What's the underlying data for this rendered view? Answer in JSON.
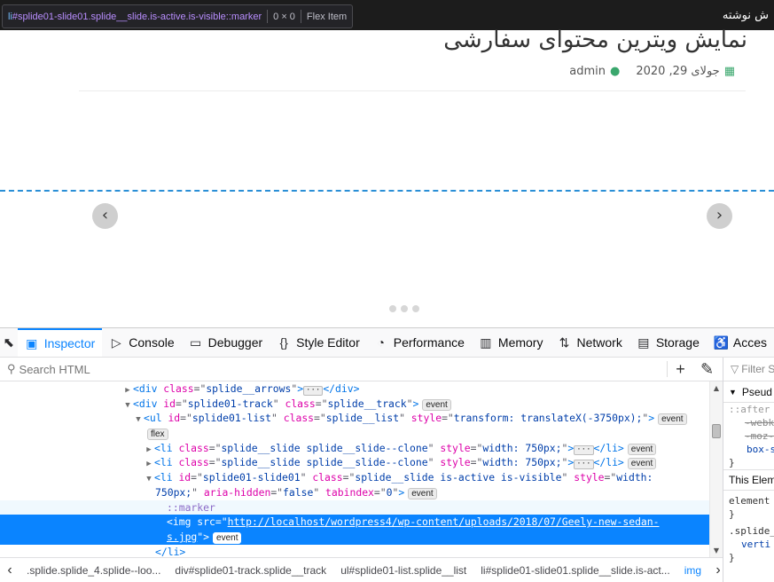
{
  "page": {
    "topbar_text": "ش نوشته",
    "post_title": "نمایش ویترین محتوای سفارشی",
    "meta_date": "جولای 29, 2020",
    "meta_author": "admin",
    "colors": {
      "accent": "#0a84ff",
      "meta_icon": "#3aa76d",
      "outline": "#2a8fd6"
    }
  },
  "tooltip": {
    "tag": "li",
    "selector": "#splide01-slide01.splide__slide.is-active.is-visible::marker",
    "size": "0 × 0",
    "layout": "Flex Item"
  },
  "devtools": {
    "tabs": [
      {
        "label": "Inspector",
        "icon": "inspector-icon"
      },
      {
        "label": "Console",
        "icon": "console-icon"
      },
      {
        "label": "Debugger",
        "icon": "debugger-icon"
      },
      {
        "label": "Style Editor",
        "icon": "style-editor-icon"
      },
      {
        "label": "Performance",
        "icon": "performance-icon"
      },
      {
        "label": "Memory",
        "icon": "memory-icon"
      },
      {
        "label": "Network",
        "icon": "network-icon"
      },
      {
        "label": "Storage",
        "icon": "storage-icon"
      },
      {
        "label": "Acces",
        "icon": "accessibility-icon"
      }
    ],
    "search_placeholder": "Search HTML",
    "markup": {
      "l1": {
        "tag": "div",
        "attr": "class",
        "val": "splide__arrows"
      },
      "l2": {
        "tag": "div",
        "a1": "id",
        "v1": "splide01-track",
        "a2": "class",
        "v2": "splide__track",
        "badge": "event"
      },
      "l3": {
        "tag": "ul",
        "a1": "id",
        "v1": "splide01-list",
        "a2": "class",
        "v2": "splide__list",
        "a3": "style",
        "v3": "transform: translateX(-3750px);",
        "badge": "event",
        "badge2": "flex"
      },
      "l4": {
        "tag": "li",
        "a1": "class",
        "v1": "splide__slide splide__slide--clone",
        "a2": "style",
        "v2": "width: 750px;",
        "badge": "event"
      },
      "l5": {
        "tag": "li",
        "a1": "class",
        "v1": "splide__slide splide__slide--clone",
        "a2": "style",
        "v2": "width: 750px;",
        "badge": "event"
      },
      "l6": {
        "tag": "li",
        "a1": "id",
        "v1": "splide01-slide01",
        "a2": "class",
        "v2": "splide__slide is-active is-visible",
        "a3": "style",
        "v3a": "width:",
        "v3b": "750px;",
        "a4": "aria-hidden",
        "v4": "false",
        "a5": "tabindex",
        "v5": "0",
        "badge": "event"
      },
      "l7": "::marker",
      "l8": {
        "tag": "img",
        "attr": "src",
        "url_a": "http://localhost/wordpress4/wp-content/uploads/2018/07/Geely-new-sedan-",
        "url_b": "s.jpg",
        "badge": "event"
      },
      "l9": "</li>"
    },
    "breadcrumbs": [
      ".splide.splide_4.splide--loo...",
      "div#splide01-track.splide__track",
      "ul#splide01-list.splide__list",
      "li#splide01-slide01.splide__slide.is-act...",
      "img"
    ],
    "side": {
      "filter": "Filter S",
      "pseudo": "Pseud",
      "after": "::after",
      "webk": "-webk",
      "moz": "-moz-",
      "box": "box-s",
      "brace": "}",
      "this_elem": "This Elem",
      "element": "element",
      "splide": ".splide_",
      "vert": "verti"
    }
  }
}
